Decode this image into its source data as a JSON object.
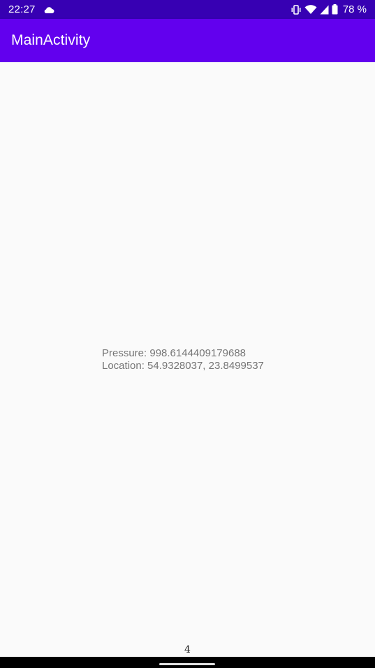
{
  "status_bar": {
    "time": "22:27",
    "battery_percent": "78 %",
    "icons": [
      "cloud-icon",
      "vibrate-icon",
      "wifi-icon",
      "cell-signal-icon",
      "battery-icon"
    ]
  },
  "app_bar": {
    "title": "MainActivity"
  },
  "readout": {
    "pressure": "Pressure: 998.6144409179688",
    "location": "Location: 54.9328037, 23.8499537"
  },
  "page_number": "4",
  "colors": {
    "status_bar": "#3700b3",
    "app_bar": "#6200ee",
    "background": "#fafafa",
    "text": "#757575"
  }
}
